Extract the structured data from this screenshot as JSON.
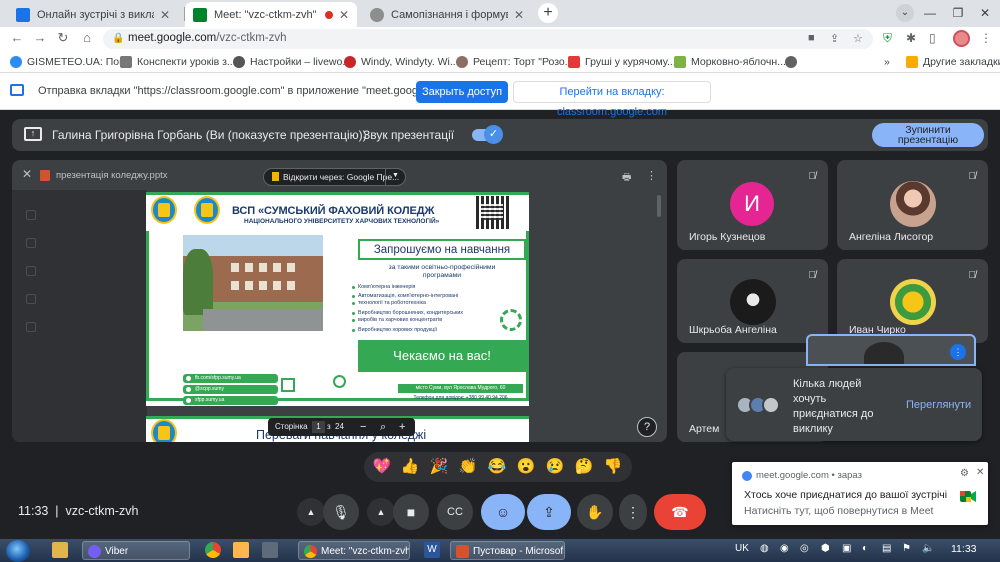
{
  "browser": {
    "tabs": [
      {
        "label": "Онлайн зустрічі з викладачами",
        "color": "#1a73e8"
      },
      {
        "label": "Meet: \"vzc-ctkm-zvh\"",
        "color": "#00832d"
      },
      {
        "label": "Самопізнання і формування осо",
        "color": "#5f6368"
      }
    ],
    "url_domain": "meet.google.com",
    "url_path": "/vzc-ctkm-zvh",
    "bookmarks": [
      "GISMETEO.UA: Пог...",
      "Конспекти уроків з...",
      "Настройки – livewo...",
      "Windy, Windyty. Wi...",
      "Рецепт: Торт \"Розо...",
      "Груші у курячому...",
      "Морковно-яблочн..."
    ],
    "other_bookmarks": "Другие закладки"
  },
  "infobar": {
    "text": "Отправка вкладки \"https://classroom.google.com\" в приложение \"meet.google.com\"...",
    "primary": "Закрыть доступ",
    "secondary": "Перейти на вкладку: classroom.google.com"
  },
  "present_bar": {
    "presenter": "Галина Григорівна Горбань (Ви (показуєте презентацію))",
    "sound_label": "Звук презентації",
    "stop_line1": "Зупинити",
    "stop_line2": "презентацію"
  },
  "presentation": {
    "file": "презентація коледжу.pptx",
    "open_with": "Відкрити через: Google Пре...",
    "page_label": "Сторінка",
    "page_current": "1",
    "page_of": "з",
    "page_total": "24"
  },
  "slide": {
    "title": "ВСП «СУМСЬКИЙ ФАХОВИЙ КОЛЕДЖ",
    "subtitle": "НАЦІОНАЛЬНОГО УНІВЕРСИТЕТУ ХАРЧОВИХ ТЕХНОЛОГІЙ»",
    "invite": "Запрошуємо на навчання",
    "programs_line1": "за такими освітньо-професійними",
    "programs_line2": "програмами",
    "bullets": [
      "Комп'ютерна інженерія",
      "Автоматизація, комп'ютерно-інтегровані",
      "технології та робототехніка",
      "Виробництво борошняних, кондитерських",
      "виробів та харчових концентратів",
      "Виробництво  хорових продукції"
    ],
    "waiting": "Чекаємо на вас!",
    "social": [
      "fb.com/sfpp.sumy.ua",
      "@scpp.sumy",
      "sfpp.sumy.ua"
    ],
    "address": "місто Суми, вул Ярослава Мудрого, 60",
    "phone": "Телефон для довідок: +380 99 40 94 206",
    "next_title": "Переваги навчання у коледжі"
  },
  "participants": [
    {
      "name": "Игорь Кузнецов",
      "initial": "И"
    },
    {
      "name": "Ангеліна Лисогор"
    },
    {
      "name": "Шкрьоба Ангеліна"
    },
    {
      "name": "Иван Чирко"
    },
    {
      "name": "Артем"
    }
  ],
  "join_popup": {
    "text": "Кілька людей хочуть приєднатися до виклику",
    "link": "Переглянути"
  },
  "reactions": [
    "💖",
    "👍",
    "🎉",
    "👏",
    "😂",
    "😮",
    "😢",
    "🤔",
    "👎"
  ],
  "meeting": {
    "time": "11:33",
    "code": "vzc-ctkm-zvh"
  },
  "notification": {
    "source": "meet.google.com • зараз",
    "line1": "Хтось хоче приєднатися до вашої зустрічі",
    "line2": "Натисніть тут, щоб повернутися в Meet"
  },
  "taskbar": {
    "items": [
      "Viber",
      "Meet: \"vzc-ctkm-zvh...",
      "Пустовар - Microsof..."
    ],
    "lang": "UK",
    "clock": "11:33"
  },
  "colors": {
    "meet_bg": "#202124",
    "tile_bg": "#3c4043",
    "accent_blue": "#8ab4f8",
    "end_call_red": "#ea4335",
    "slide_green": "#35a853"
  }
}
